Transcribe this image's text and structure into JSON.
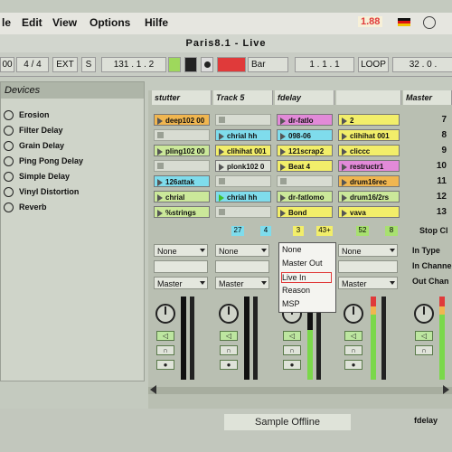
{
  "menu": {
    "items": [
      "le",
      "Edit",
      "View",
      "Options",
      "Hilfe"
    ],
    "cpu": "1.88",
    "flag": "de-flag-icon"
  },
  "title": "Paris8.1 - Live",
  "transport": {
    "sig_left": "00",
    "sig": "4 / 4",
    "ext": "EXT",
    "s": "S",
    "tempo": "131 . 1 . 2",
    "quant": "Bar",
    "pos": "1 . 1 . 1",
    "loop": "LOOP",
    "len": "32 . 0 ."
  },
  "browser": {
    "header": "Devices",
    "items": [
      "Erosion",
      "Filter Delay",
      "Grain Delay",
      "Ping Pong Delay",
      "Simple Delay",
      "Vinyl Distortion",
      "Reverb"
    ]
  },
  "tracks": [
    {
      "name": "stutter",
      "clips": [
        "deep102 00",
        "",
        "pling102 00",
        "",
        "126attak",
        "chrial",
        "%strings"
      ]
    },
    {
      "name": "Track 5",
      "clips": [
        "",
        "chrial hh",
        "clihihat 001",
        "plonk102 0",
        "",
        "chrial hh",
        ""
      ]
    },
    {
      "name": "fdelay",
      "clips": [
        "dr-fatlo",
        "098-06",
        "121scrap2",
        "Beat 4",
        "",
        "dr-fatlomo",
        "Bond"
      ]
    },
    {
      "name": "",
      "clips": [
        "2",
        "clihihat 001",
        "cliccc",
        "restructr1",
        "drum16rec",
        "drum16/2rs",
        "vava"
      ]
    }
  ],
  "master": {
    "name": "Master",
    "scenes": [
      "7",
      "8",
      "9",
      "10",
      "11",
      "12",
      "13"
    ],
    "stop": "Stop Cl",
    "labels": [
      "In Type",
      "In Channe",
      "Out Chan"
    ]
  },
  "io": {
    "none": "None",
    "master": "Master"
  },
  "counters": [
    {
      "a": "27",
      "b": "4"
    },
    {
      "a": "3",
      "b": "43+"
    },
    {
      "a": "52",
      "b": "8"
    }
  ],
  "dropdown": {
    "items": [
      "None",
      "Master Out",
      "Live In",
      "Reason",
      "MSP"
    ],
    "selected": "Live In"
  },
  "status": {
    "offline": "Sample Offline",
    "track": "fdelay"
  },
  "colors": {
    "orange": "#f0b650",
    "yellow": "#f2ee6a",
    "cyan": "#7fdcec",
    "pink": "#e28ad8",
    "green": "#a8e070",
    "blue": "#6fa8e8",
    "red": "#e03a3a",
    "lightgreen": "#cbe89a"
  }
}
